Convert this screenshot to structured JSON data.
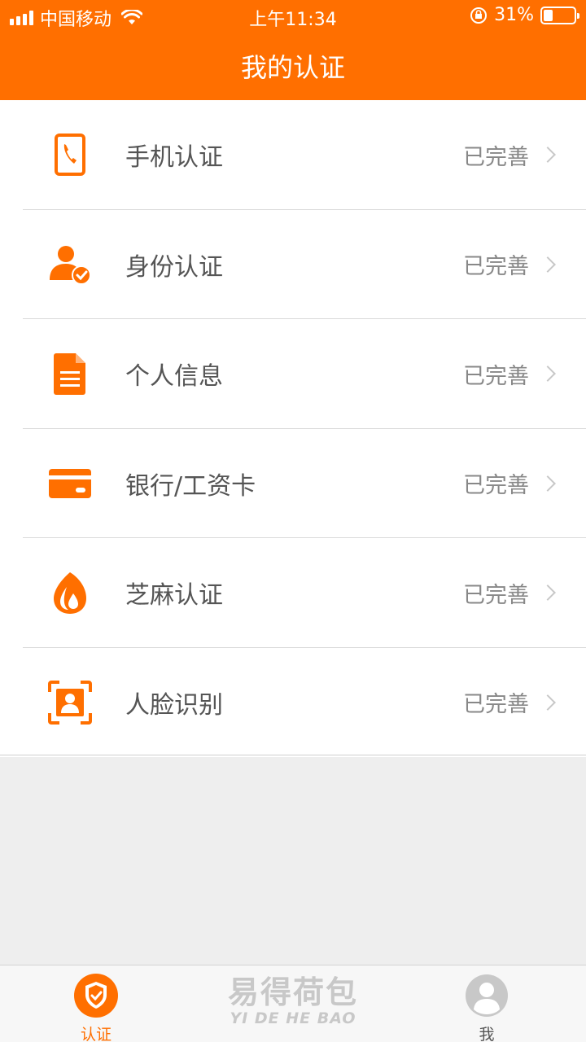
{
  "status_bar": {
    "carrier": "中国移动",
    "time": "上午11:34",
    "battery_percent": "31%",
    "battery_level": 0.31
  },
  "header": {
    "title": "我的认证"
  },
  "colors": {
    "accent": "#ff6f00",
    "background": "#eeeeee"
  },
  "items": [
    {
      "label": "手机认证",
      "status": "已完善",
      "icon": "phone-icon"
    },
    {
      "label": "身份认证",
      "status": "已完善",
      "icon": "user-check-icon"
    },
    {
      "label": "个人信息",
      "status": "已完善",
      "icon": "document-icon"
    },
    {
      "label": "银行/工资卡",
      "status": "已完善",
      "icon": "card-icon"
    },
    {
      "label": "芝麻认证",
      "status": "已完善",
      "icon": "sesame-icon"
    },
    {
      "label": "人脸识别",
      "status": "已完善",
      "icon": "face-scan-icon"
    }
  ],
  "tabbar": {
    "tabs": [
      {
        "label": "认证",
        "icon": "shield-check-icon",
        "active": true
      },
      {
        "label": "我",
        "icon": "profile-icon",
        "active": false
      }
    ],
    "logo_cn": "易得荷包",
    "logo_en": "YI DE HE BAO"
  }
}
